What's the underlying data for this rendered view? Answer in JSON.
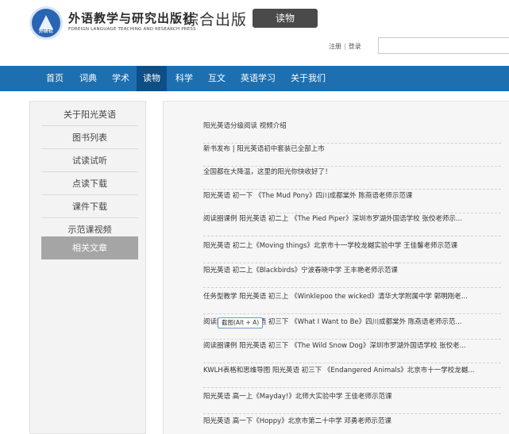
{
  "header": {
    "logo_text": "外研社",
    "brand_cn": "外语教学与研究出版社",
    "brand_en": "FOREIGN LANGUAGE TEACHING AND RESEARCH PRESS",
    "site_title": "综合出版",
    "section_badge": "读物",
    "auth": {
      "register": "注册",
      "separator": "|",
      "login": "登录"
    },
    "search": {
      "value": "",
      "placeholder": ""
    }
  },
  "nav": {
    "items": [
      {
        "label": "首页"
      },
      {
        "label": "词典"
      },
      {
        "label": "学术"
      },
      {
        "label": "读物",
        "active": true
      },
      {
        "label": "科学"
      },
      {
        "label": "互文"
      },
      {
        "label": "英语学习"
      },
      {
        "label": "关于我们"
      }
    ]
  },
  "sidebar": {
    "items": [
      {
        "label": "关于阳光英语"
      },
      {
        "label": "图书列表"
      },
      {
        "label": "试读试听"
      },
      {
        "label": "点读下载"
      },
      {
        "label": "课件下载"
      },
      {
        "label": "示范课视频"
      },
      {
        "label": "相关文章",
        "active": true
      }
    ]
  },
  "articles": [
    "阳光英语分级阅读 视频介绍",
    "新书发布 | 阳光英语初中套装已全部上市",
    "全国都在大降温，这里的阳光你快收好了！",
    "阳光英语 初一下 《The Mud Pony》四川成都棠外 陈燕语老师示范课",
    "阅读圈课例 阳光英语 初二上 《The Pied Piper》深圳市罗湖外国语学校 张佼老师示...",
    "阳光英语 初二上《Moving things》北京市十一学校龙樾实验中学 王佳馨老师示范课",
    "阳光英语 初二上《Blackbirds》宁波春晓中学 王丰艳老师示范课",
    "任务型教学 阳光英语 初三上 《Winklepoo the wicked》清华大学附属中学 郭明刚老...",
    "阅读圈课例 阳光英语 初三下 《What I Want to Be》四川成都棠外 陈燕语老师示范...",
    "阅读圈课例 阳光英语 初三下 《The Wild Snow Dog》深圳市罗湖外国语学校 张佼老...",
    "KWLH表格和思维导图 阳光英语 初三下 《Endangered Animals》北京市十一学校龙樾...",
    "阳光英语 高一上《Mayday!》北师大实验中学 王佳老师示范课",
    "阳光英语 高一下《Hoppy》北京市第二十中学 邓勇老师示范课"
  ],
  "tooltip": {
    "text": "截图(Alt + A)"
  }
}
